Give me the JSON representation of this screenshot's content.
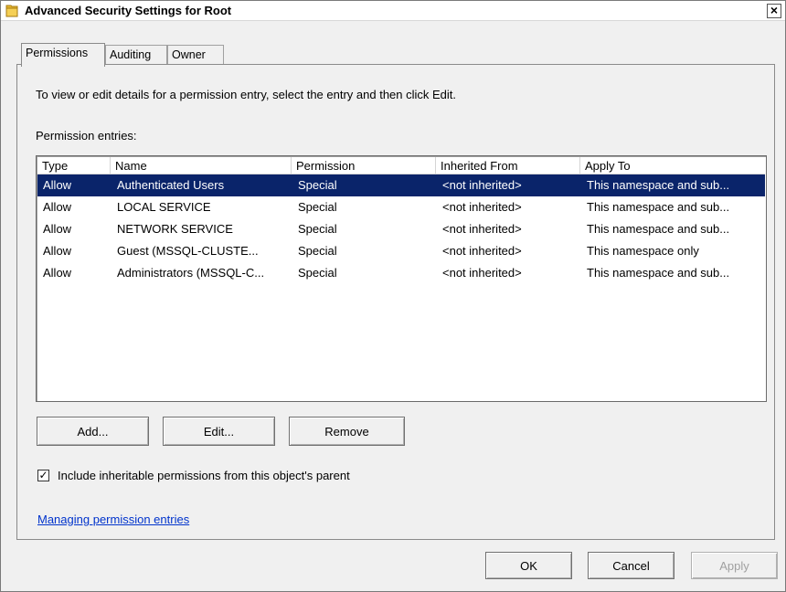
{
  "window": {
    "title": "Advanced Security Settings for Root",
    "close_label": "×"
  },
  "tabs": [
    {
      "label": "Permissions",
      "active": true
    },
    {
      "label": "Auditing",
      "active": false
    },
    {
      "label": "Owner",
      "active": false
    }
  ],
  "permissions": {
    "instruction": "To view or edit details for a permission entry, select the entry and then click Edit.",
    "entries_label": "Permission entries:",
    "columns": [
      "Type",
      "Name",
      "Permission",
      "Inherited From",
      "Apply To"
    ],
    "rows": [
      {
        "type": "Allow",
        "name": "Authenticated Users",
        "permission": "Special",
        "inherited_from": "<not inherited>",
        "apply_to": "This namespace and sub..."
      },
      {
        "type": "Allow",
        "name": "LOCAL SERVICE",
        "permission": "Special",
        "inherited_from": "<not inherited>",
        "apply_to": "This namespace and sub..."
      },
      {
        "type": "Allow",
        "name": "NETWORK SERVICE",
        "permission": "Special",
        "inherited_from": "<not inherited>",
        "apply_to": "This namespace and sub..."
      },
      {
        "type": "Allow",
        "name": "Guest (MSSQL-CLUSTE...",
        "permission": "Special",
        "inherited_from": "<not inherited>",
        "apply_to": "This namespace only"
      },
      {
        "type": "Allow",
        "name": "Administrators (MSSQL-C...",
        "permission": "Special",
        "inherited_from": "<not inherited>",
        "apply_to": "This namespace and sub..."
      }
    ],
    "selected_row": 0,
    "add_label": "Add...",
    "edit_label": "Edit...",
    "remove_label": "Remove",
    "inherit_checked": true,
    "inherit_check_mark": "✓",
    "inherit_label": "Include inheritable permissions from this object's parent",
    "help_link": "Managing permission entries"
  },
  "footer": {
    "ok_label": "OK",
    "cancel_label": "Cancel",
    "apply_label": "Apply",
    "apply_enabled": false
  },
  "colors": {
    "selection": "#0a246a",
    "link": "#0033cc",
    "folder_icon": "#e8b830"
  }
}
